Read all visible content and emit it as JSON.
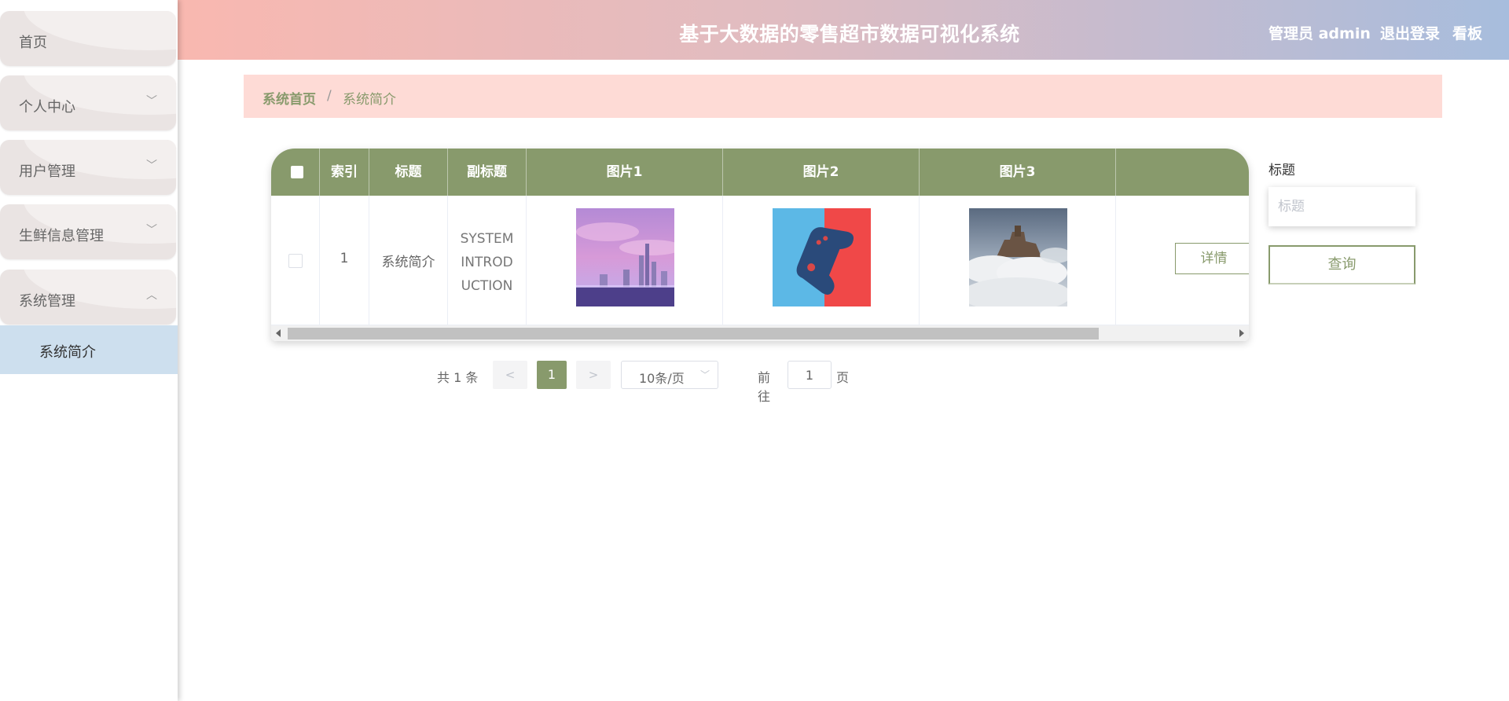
{
  "header": {
    "title": "基于大数据的零售超市数据可视化系统",
    "user": "管理员 admin",
    "logout": "退出登录",
    "board": "看板"
  },
  "sidebar": {
    "items": [
      {
        "label": "首页",
        "chevron": ""
      },
      {
        "label": "个人中心",
        "chevron": "﹀"
      },
      {
        "label": "用户管理",
        "chevron": "﹀"
      },
      {
        "label": "生鲜信息管理",
        "chevron": "﹀"
      },
      {
        "label": "系统管理",
        "chevron": "︿"
      }
    ],
    "submenu": [
      {
        "label": "系统简介"
      }
    ]
  },
  "breadcrumb": {
    "home": "系统首页",
    "separator": "/",
    "current": "系统简介"
  },
  "table": {
    "columns": [
      "索引",
      "标题",
      "副标题",
      "图片1",
      "图片2",
      "图片3",
      ""
    ],
    "rows": [
      {
        "index": "1",
        "title": "系统简介",
        "subtitle_lines": [
          "SYSTEM",
          "INTROD",
          "UCTION"
        ],
        "action": "详情"
      }
    ]
  },
  "pagination": {
    "total": "共 1 条",
    "prev": "<",
    "next": ">",
    "current_page": "1",
    "page_size": "10条/页",
    "goto_prefix": "前往",
    "goto_value": "1",
    "goto_suffix": "页"
  },
  "search": {
    "label": "标题",
    "placeholder": "标题",
    "button": "查询"
  },
  "colors": {
    "accent": "#889a6c",
    "breadcrumb_bg": "#fedbd6",
    "submenu_active": "#cddfee"
  }
}
